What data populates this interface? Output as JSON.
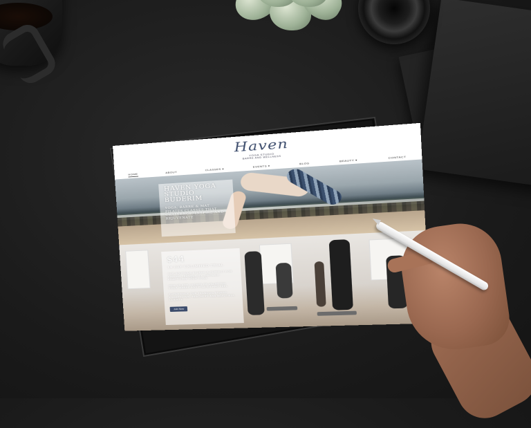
{
  "site": {
    "logo": "Haven",
    "logo_sub": "YOGA STUDIO",
    "logo_sub2": "BARRE AND WELLNESS",
    "nav": [
      "HOME",
      "ABOUT",
      "CLASSES ▾",
      "EVENTS ▾",
      "BLOG",
      "BEAUTY ▾",
      "CONTACT"
    ]
  },
  "hero": {
    "title": "HAVEN YOGA STUDIO BUDERIM",
    "subtitle": "YOGA, BARRE & MAT PILATES CLASSES THAT CHALLENGE, INSPIRE AND REJUVENATE"
  },
  "offer": {
    "price": "$44",
    "title": "14 DAY UNLIMITED TRIAL",
    "paragraph1": "OUR BOUTIQUE STUDIO IS PERFECT FOR FINDING TRANQUILITY THROUGH PRACTICING YOUR YOGA",
    "paragraph2": "JOIN US FOR 14 DAYS OF UNLIMITED YOGA, BARRE AND PILATES AND FEEL",
    "paragraph3": "EXPERIENCE OUR TRANQUIL STUDIO, EXCEPTIONAL TEACHERS AND BEAUTIFUL CLIENTS",
    "button": "Join Now"
  }
}
